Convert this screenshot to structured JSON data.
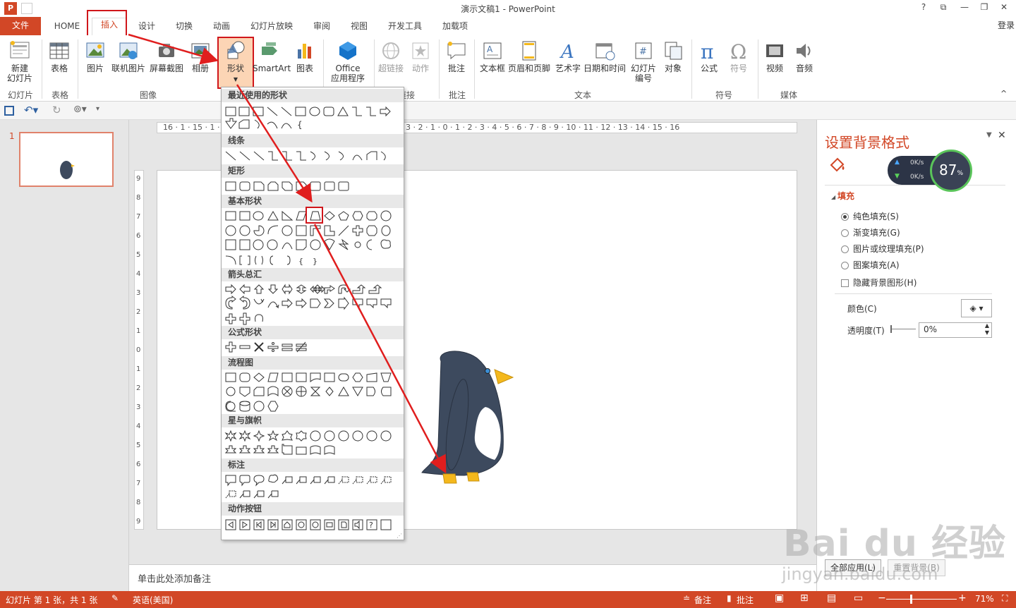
{
  "app": {
    "logo": "P",
    "title": "演示文稿1 - PowerPoint",
    "help": "?",
    "login": "登录"
  },
  "tabs": [
    {
      "label": "文件"
    },
    {
      "label": "HOME"
    },
    {
      "label": "插入"
    },
    {
      "label": "设计"
    },
    {
      "label": "切换"
    },
    {
      "label": "动画"
    },
    {
      "label": "幻灯片放映"
    },
    {
      "label": "审阅"
    },
    {
      "label": "视图"
    },
    {
      "label": "开发工具"
    },
    {
      "label": "加载项"
    }
  ],
  "ribbon": {
    "new_slide": "新建\n幻灯片",
    "table": "表格",
    "picture": "图片",
    "online_picture": "联机图片",
    "screenshot": "屏幕截图",
    "album": "相册",
    "shapes": "形状",
    "smartart": "SmartArt",
    "chart": "图表",
    "office_apps": "Office\n应用程序",
    "hyperlink": "超链接",
    "action": "动作",
    "comment": "批注",
    "textbox": "文本框",
    "header_footer": "页眉和页脚",
    "wordart": "艺术字",
    "datetime": "日期和时间",
    "slide_number": "幻灯片\n编号",
    "object": "对象",
    "equation": "公式",
    "symbol": "符号",
    "video": "视频",
    "audio": "音频",
    "groups": {
      "slides": "幻灯片",
      "tables": "表格",
      "images": "图像",
      "links": "链接",
      "comments": "批注",
      "text": "文本",
      "symbols": "符号",
      "media": "媒体"
    }
  },
  "shapes_gallery": {
    "sections": [
      "最近使用的形状",
      "线条",
      "矩形",
      "基本形状",
      "箭头总汇",
      "公式形状",
      "流程图",
      "星与旗帜",
      "标注",
      "动作按钮"
    ]
  },
  "thumbnail": {
    "number": "1"
  },
  "ruler": {
    "h_ticks": "16 · 1 · 15 · 1 · 14",
    "h_ticks_right": "3 · 2 · 1 · 0 · 1 · 2 · 3 · 4 · 5 · 6 · 7 · 8 · 9 · 10 · 11 · 12 · 13 · 14 · 15 · 16",
    "v_ticks": [
      "9",
      "8",
      "7",
      "6",
      "5",
      "4",
      "3",
      "2",
      "1",
      "0",
      "1",
      "2",
      "3",
      "4",
      "5",
      "6",
      "7",
      "8",
      "9"
    ]
  },
  "notes": {
    "placeholder": "单击此处添加备注"
  },
  "format_pane": {
    "title": "设置背景格式",
    "section": "填充",
    "options": [
      {
        "label": "纯色填充(S)",
        "selected": true
      },
      {
        "label": "渐变填充(G)",
        "selected": false
      },
      {
        "label": "图片或纹理填充(P)",
        "selected": false
      },
      {
        "label": "图案填充(A)",
        "selected": false
      }
    ],
    "hide_bg": "隐藏背景图形(H)",
    "color_label": "颜色(C)",
    "transparency_label": "透明度(T)",
    "transparency_value": "0%",
    "apply_all": "全部应用(L)",
    "reset_bg": "重置背景(B)"
  },
  "net_widget": {
    "up": "0K/s",
    "down": "0K/s",
    "percent": "87",
    "percent_unit": "%"
  },
  "status": {
    "slide_info": "幻灯片 第 1 张，共 1 张",
    "language": "英语(美国)",
    "notes": "备注",
    "comments": "批注",
    "zoom": "71%"
  },
  "watermark": {
    "logo": "Bai du 经验",
    "url": "jingyan.baidu.com"
  },
  "colors": {
    "accent": "#d24726",
    "highlight": "#d0161b",
    "penguin_body": "#3d4a5e",
    "penguin_beak": "#f4b81c"
  }
}
